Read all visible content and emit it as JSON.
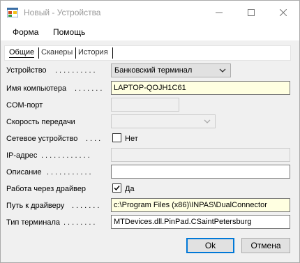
{
  "window": {
    "title": "Новый - Устройства"
  },
  "menu": {
    "items": [
      "Форма",
      "Помощь"
    ]
  },
  "tabs": {
    "items": [
      "Общие",
      "Сканеры",
      "История"
    ]
  },
  "form": {
    "device": {
      "label": "Устройство",
      "value": "Банковский терминал"
    },
    "computer_name": {
      "label": "Имя компьютера",
      "value": "LAPTOP-QOJH1C61"
    },
    "com_port": {
      "label": "COM-порт",
      "value": ""
    },
    "baud_rate": {
      "label": "Скорость передачи",
      "value": ""
    },
    "network_device": {
      "label": "Сетевое устройство",
      "checked": false,
      "check_label": "Нет"
    },
    "ip_address": {
      "label": "IP-адрес",
      "value": ""
    },
    "description": {
      "label": "Описание",
      "value": ""
    },
    "via_driver": {
      "label": "Работа через драйвер",
      "checked": true,
      "check_label": "Да"
    },
    "driver_path": {
      "label": "Путь к драйверу",
      "value": "c:\\Program Files (x86)\\INPAS\\DualConnector"
    },
    "terminal_type": {
      "label": "Тип терминала",
      "value": "MTDevices.dll.PinPad.CSaintPetersburg"
    }
  },
  "buttons": {
    "ok": "Ok",
    "cancel": "Отмена"
  },
  "icons": {
    "app": "app-window-icon",
    "minimize": "minimize-icon",
    "maximize": "maximize-icon",
    "close": "close-icon",
    "combo": "chevron-down-icon",
    "check": "checkmark-icon"
  },
  "colors": {
    "highlight_field": "#ffffe1",
    "ok_border": "#0078d7",
    "window_bg": "#f0f0f0"
  }
}
